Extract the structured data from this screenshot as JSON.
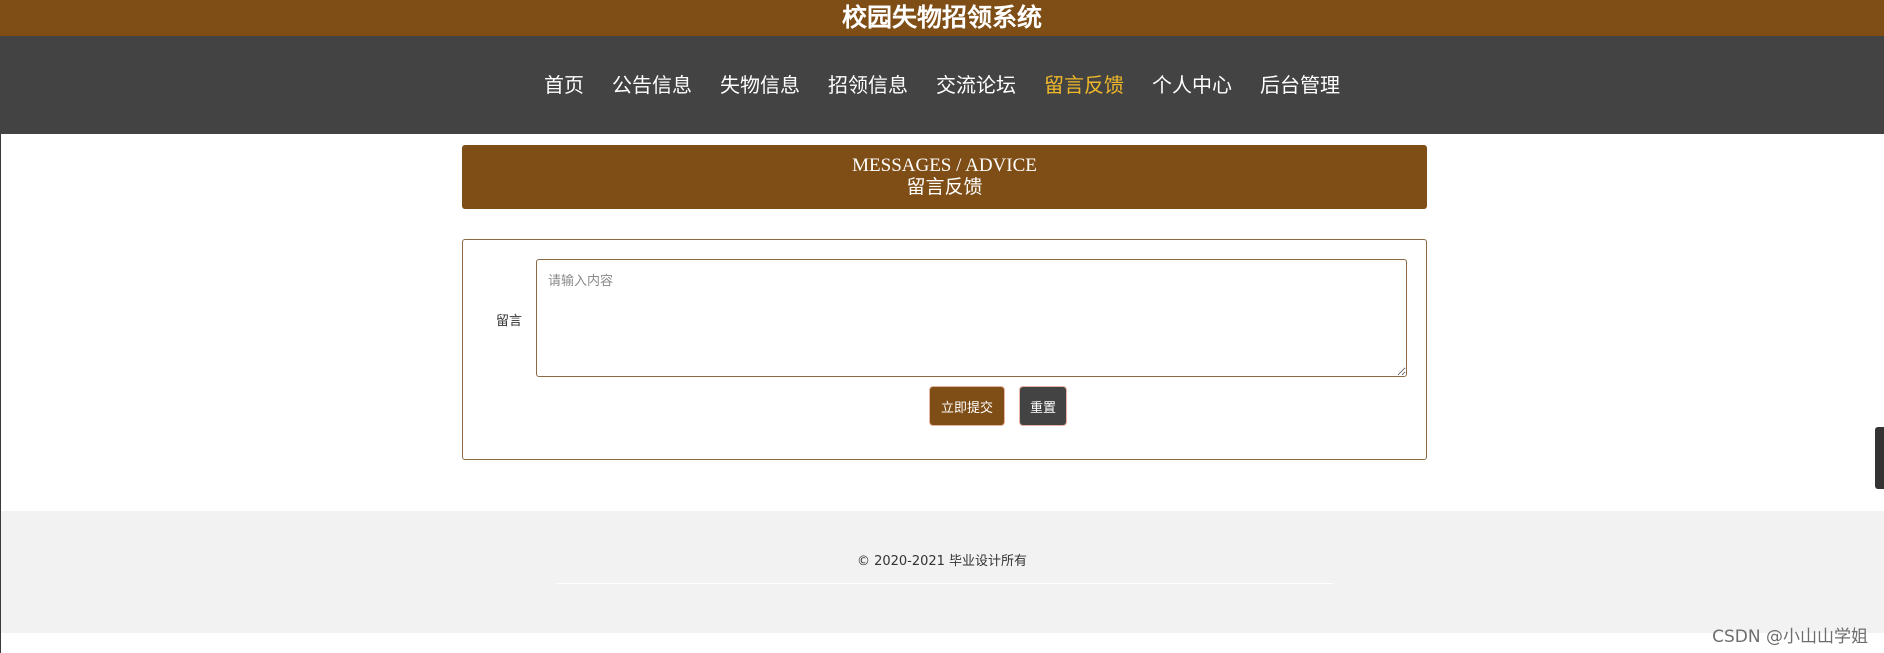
{
  "site": {
    "title": "校园失物招领系统"
  },
  "nav": {
    "items": [
      {
        "label": "首页",
        "active": false
      },
      {
        "label": "公告信息",
        "active": false
      },
      {
        "label": "失物信息",
        "active": false
      },
      {
        "label": "招领信息",
        "active": false
      },
      {
        "label": "交流论坛",
        "active": false
      },
      {
        "label": "留言反馈",
        "active": true
      },
      {
        "label": "个人中心",
        "active": false
      },
      {
        "label": "后台管理",
        "active": false
      }
    ]
  },
  "section": {
    "title_en": "MESSAGES / ADVICE",
    "title_cn": "留言反馈"
  },
  "form": {
    "message_label": "留言",
    "message_placeholder": "请输入内容",
    "message_value": "",
    "submit_label": "立即提交",
    "reset_label": "重置"
  },
  "footer": {
    "copyright": "© 2020-2021 毕业设计所有"
  },
  "watermark": "CSDN @小山山学姐",
  "colors": {
    "brand_brown": "#7f4e16",
    "nav_dark": "#434343",
    "nav_active": "#f0b828"
  }
}
